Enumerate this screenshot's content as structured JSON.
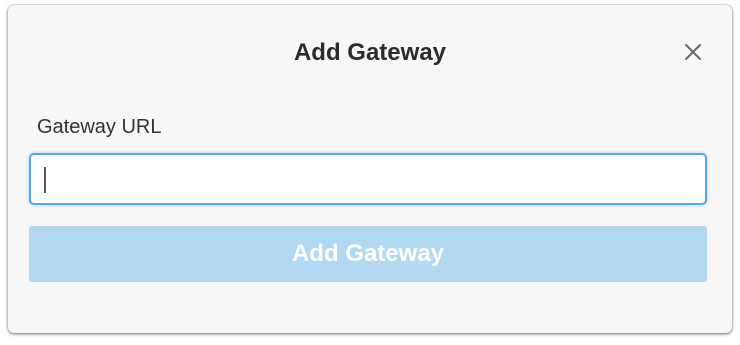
{
  "dialog": {
    "title": "Add Gateway",
    "close_icon": "close-icon",
    "field_label": "Gateway URL",
    "input_value": "",
    "input_placeholder": "",
    "submit_label": "Add Gateway",
    "submit_disabled": true
  },
  "colors": {
    "dialog_background": "#f7f7f7",
    "title_text": "#2b2b2b",
    "input_focus_border": "#5aa9e0",
    "submit_background_disabled": "#b3d9f2",
    "submit_text": "#ffffff",
    "close_icon": "#6a6a6a"
  }
}
